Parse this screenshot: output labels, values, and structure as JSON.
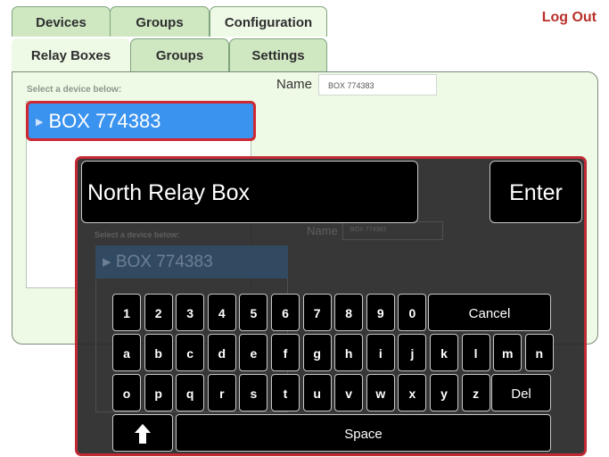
{
  "top_tabs": [
    {
      "label": "Devices",
      "active": false
    },
    {
      "label": "Groups",
      "active": false
    },
    {
      "label": "Configuration",
      "active": true
    }
  ],
  "sub_tabs": [
    {
      "label": "Relay Boxes",
      "active": true
    },
    {
      "label": "Groups",
      "active": false
    },
    {
      "label": "Settings",
      "active": false
    }
  ],
  "logout_label": "Log Out",
  "panel": {
    "hint": "Select a device below:",
    "name_label": "Name",
    "name_value": "BOX 774383",
    "devices": [
      {
        "label": "BOX 774383",
        "selected": true
      }
    ]
  },
  "keyboard": {
    "input_value": "North Relay Box",
    "enter_label": "Enter",
    "rows": [
      [
        "1",
        "2",
        "3",
        "4",
        "5",
        "6",
        "7",
        "8",
        "9",
        "0"
      ],
      [
        "a",
        "b",
        "c",
        "d",
        "e",
        "f",
        "g",
        "h",
        "i",
        "j",
        "k",
        "l",
        "m",
        "n"
      ],
      [
        "o",
        "p",
        "q",
        "r",
        "s",
        "t",
        "u",
        "v",
        "w",
        "x",
        "y",
        "z"
      ]
    ],
    "cancel_label": "Cancel",
    "del_label": "Del",
    "space_label": "Space",
    "shift_icon": "up-arrow-icon"
  },
  "colors": {
    "accent_red": "#c12a35",
    "selection_blue": "#3b93f0",
    "panel_green": "#eefae6",
    "tab_green": "#cfe8c2",
    "logout_red": "#b8302a"
  }
}
